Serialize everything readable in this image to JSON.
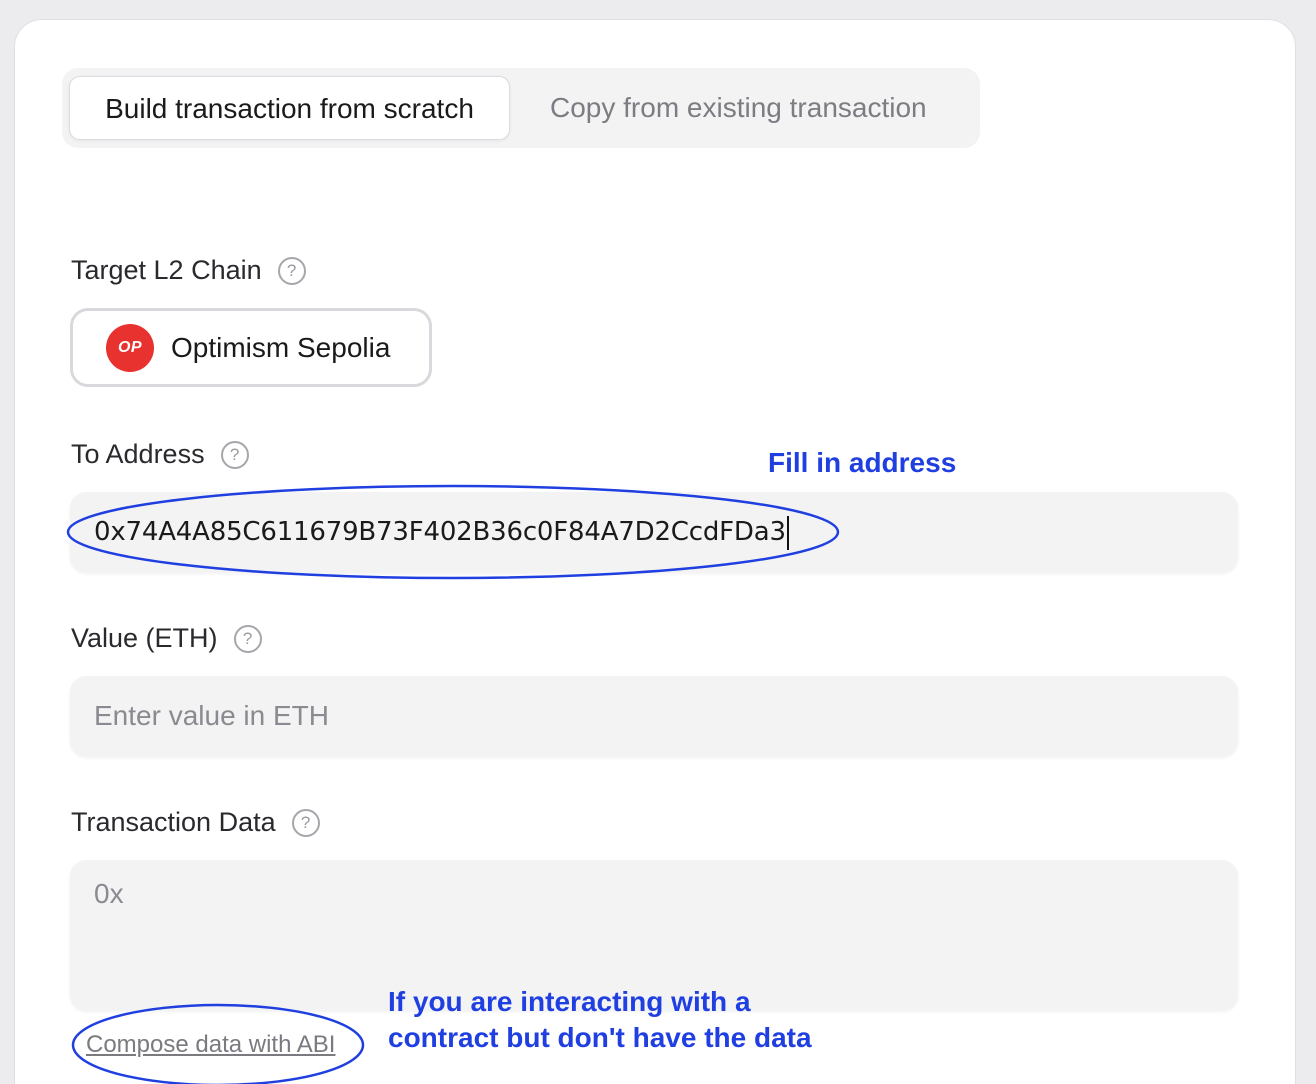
{
  "tabs": {
    "build": "Build transaction from scratch",
    "copy": "Copy from existing transaction"
  },
  "target_chain": {
    "label": "Target L2 Chain",
    "logo_text": "OP",
    "name": "Optimism Sepolia"
  },
  "to_address": {
    "label": "To Address",
    "value": "0x74A4A85C611679B73F402B36c0F84A7D2CcdFDa3"
  },
  "value_eth": {
    "label": "Value (ETH)",
    "placeholder": "Enter value in ETH"
  },
  "transaction_data": {
    "label": "Transaction Data",
    "placeholder": "0x"
  },
  "compose_link": "Compose data with ABI",
  "help_glyph": "?",
  "annotations": {
    "fill_address": "Fill in address",
    "abi_line1": "If you are interacting with a",
    "abi_line2": "contract but don't have the data"
  },
  "colors": {
    "annotation": "#1f3fe0",
    "op_brand": "#e8322f"
  }
}
